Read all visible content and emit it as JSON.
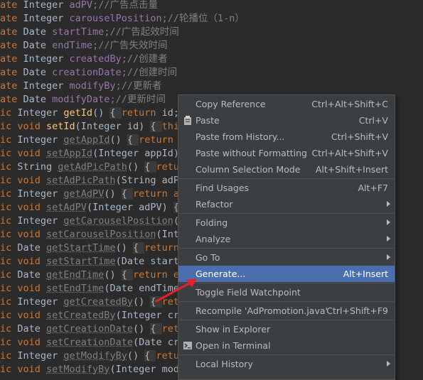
{
  "code": {
    "lines": [
      {
        "parts": [
          {
            "t": "ate ",
            "c": "kw"
          },
          {
            "t": "Integer ",
            "c": ""
          },
          {
            "t": "adPV",
            "c": "fld"
          },
          {
            "t": ";//广告点击量",
            "c": "cm"
          }
        ]
      },
      {
        "parts": [
          {
            "t": "ate ",
            "c": "kw"
          },
          {
            "t": "Integer ",
            "c": ""
          },
          {
            "t": "carouselPosition",
            "c": "fld"
          },
          {
            "t": ";//轮播位（1-n）",
            "c": "cm"
          }
        ]
      },
      {
        "parts": [
          {
            "t": "ate ",
            "c": "kw"
          },
          {
            "t": "Date ",
            "c": ""
          },
          {
            "t": "startTime",
            "c": "fld"
          },
          {
            "t": ";//广告起效时间",
            "c": "cm"
          }
        ]
      },
      {
        "parts": [
          {
            "t": "ate ",
            "c": "kw"
          },
          {
            "t": "Date ",
            "c": ""
          },
          {
            "t": "endTime",
            "c": "fld"
          },
          {
            "t": ";//广告失效时间",
            "c": "cm"
          }
        ]
      },
      {
        "parts": [
          {
            "t": "ate ",
            "c": "kw"
          },
          {
            "t": "Integer ",
            "c": ""
          },
          {
            "t": "createdBy",
            "c": "fld"
          },
          {
            "t": ";//创建者",
            "c": "cm"
          }
        ]
      },
      {
        "parts": [
          {
            "t": "ate ",
            "c": "kw"
          },
          {
            "t": "Date ",
            "c": ""
          },
          {
            "t": "creationDate",
            "c": "fld"
          },
          {
            "t": ";//创建时间",
            "c": "cm"
          }
        ]
      },
      {
        "parts": [
          {
            "t": "ate ",
            "c": "kw"
          },
          {
            "t": "Integer ",
            "c": ""
          },
          {
            "t": "modifyBy",
            "c": "fld"
          },
          {
            "t": ";//更新者",
            "c": "cm"
          }
        ]
      },
      {
        "parts": [
          {
            "t": "ate ",
            "c": "kw"
          },
          {
            "t": "Date ",
            "c": ""
          },
          {
            "t": "modifyDate",
            "c": "fld"
          },
          {
            "t": ";//更新时间",
            "c": "cm"
          }
        ]
      },
      {
        "parts": [
          {
            "t": "ic ",
            "c": "kw"
          },
          {
            "t": "Integer ",
            "c": ""
          },
          {
            "t": "getId",
            "c": "fn"
          },
          {
            "t": "() ",
            "c": ""
          },
          {
            "t": "{ ",
            "c": "brace"
          },
          {
            "t": "return ",
            "c": "kw"
          },
          {
            "t": "id;",
            "c": ""
          }
        ]
      },
      {
        "parts": [
          {
            "t": "ic ",
            "c": "kw"
          },
          {
            "t": "void ",
            "c": "kw"
          },
          {
            "t": "setId",
            "c": "fn"
          },
          {
            "t": "(Integer id) ",
            "c": ""
          },
          {
            "t": "{ ",
            "c": "brace"
          },
          {
            "t": "this",
            "c": "kw"
          }
        ]
      },
      {
        "parts": [
          {
            "t": "ic ",
            "c": "kw"
          },
          {
            "t": "Integer ",
            "c": ""
          },
          {
            "t": "getAppId",
            "c": "dim"
          },
          {
            "t": "() ",
            "c": ""
          },
          {
            "t": "{ ",
            "c": "brace"
          },
          {
            "t": "return a",
            "c": "kw"
          }
        ]
      },
      {
        "parts": [
          {
            "t": "ic ",
            "c": "kw"
          },
          {
            "t": "void ",
            "c": "kw"
          },
          {
            "t": "setAppId",
            "c": "dim"
          },
          {
            "t": "(Integer appId) ",
            "c": ""
          }
        ]
      },
      {
        "parts": [
          {
            "t": "ic ",
            "c": "kw"
          },
          {
            "t": "String ",
            "c": ""
          },
          {
            "t": "getAdPicPath",
            "c": "dim"
          },
          {
            "t": "() ",
            "c": ""
          },
          {
            "t": "{ ",
            "c": "brace"
          },
          {
            "t": "retur",
            "c": "kw"
          }
        ]
      },
      {
        "parts": [
          {
            "t": "ic ",
            "c": "kw"
          },
          {
            "t": "void ",
            "c": "kw"
          },
          {
            "t": "setAdPicPath",
            "c": "dim"
          },
          {
            "t": "(String adPi",
            "c": ""
          }
        ]
      },
      {
        "parts": [
          {
            "t": "ic ",
            "c": "kw"
          },
          {
            "t": "Integer ",
            "c": ""
          },
          {
            "t": "getAdPV",
            "c": "dim"
          },
          {
            "t": "() ",
            "c": ""
          },
          {
            "t": "{ ",
            "c": "brace"
          },
          {
            "t": "return ad",
            "c": "kw"
          }
        ]
      },
      {
        "parts": [
          {
            "t": "ic ",
            "c": "kw"
          },
          {
            "t": "void ",
            "c": "kw"
          },
          {
            "t": "setAdPV",
            "c": "dim"
          },
          {
            "t": "(Integer adPV) ",
            "c": ""
          },
          {
            "t": "{",
            "c": "brace"
          }
        ]
      },
      {
        "parts": [
          {
            "t": "ic ",
            "c": "kw"
          },
          {
            "t": "Integer ",
            "c": ""
          },
          {
            "t": "getCarouselPosition",
            "c": "dim"
          },
          {
            "t": "()",
            "c": ""
          }
        ]
      },
      {
        "parts": [
          {
            "t": "ic ",
            "c": "kw"
          },
          {
            "t": "void ",
            "c": "kw"
          },
          {
            "t": "setCarouselPosition",
            "c": "dim"
          },
          {
            "t": "(Inte",
            "c": ""
          },
          {
            "t": "                       ositi",
            "c": ""
          }
        ]
      },
      {
        "parts": [
          {
            "t": "ic ",
            "c": "kw"
          },
          {
            "t": "Date ",
            "c": ""
          },
          {
            "t": "getStartTime",
            "c": "dim"
          },
          {
            "t": "() ",
            "c": ""
          },
          {
            "t": "{ ",
            "c": "brace"
          },
          {
            "t": "return",
            "c": "kw"
          }
        ]
      },
      {
        "parts": [
          {
            "t": "ic ",
            "c": "kw"
          },
          {
            "t": "void ",
            "c": "kw"
          },
          {
            "t": "setStartTime",
            "c": "dim"
          },
          {
            "t": "(Date startT",
            "c": ""
          }
        ]
      },
      {
        "parts": [
          {
            "t": "ic ",
            "c": "kw"
          },
          {
            "t": "Date ",
            "c": ""
          },
          {
            "t": "getEndTime",
            "c": "dim"
          },
          {
            "t": "() ",
            "c": ""
          },
          {
            "t": "{ ",
            "c": "brace"
          },
          {
            "t": "return en",
            "c": "kw"
          }
        ]
      },
      {
        "parts": [
          {
            "t": "ic ",
            "c": "kw"
          },
          {
            "t": "void ",
            "c": "kw"
          },
          {
            "t": "setEndTime",
            "c": "dim"
          },
          {
            "t": "(Date endTime)",
            "c": ""
          }
        ]
      },
      {
        "parts": [
          {
            "t": "ic ",
            "c": "kw"
          },
          {
            "t": "Integer ",
            "c": ""
          },
          {
            "t": "getCreatedBy",
            "c": "dim"
          },
          {
            "t": "() ",
            "c": ""
          },
          {
            "t": "{ ",
            "c": "brace"
          },
          {
            "t": "retu",
            "c": "kw"
          }
        ]
      },
      {
        "parts": [
          {
            "t": "ic ",
            "c": "kw"
          },
          {
            "t": "void ",
            "c": "kw"
          },
          {
            "t": "setCreatedBy",
            "c": "dim"
          },
          {
            "t": "(Integer cre",
            "c": ""
          }
        ]
      },
      {
        "parts": [
          {
            "t": "ic ",
            "c": "kw"
          },
          {
            "t": "Date ",
            "c": ""
          },
          {
            "t": "getCreationDate",
            "c": "dim"
          },
          {
            "t": "() ",
            "c": ""
          },
          {
            "t": "{ ",
            "c": "brace"
          },
          {
            "t": "retu",
            "c": "kw"
          }
        ]
      },
      {
        "parts": [
          {
            "t": "ic ",
            "c": "kw"
          },
          {
            "t": "void ",
            "c": "kw"
          },
          {
            "t": "setCreationDate",
            "c": "dim"
          },
          {
            "t": "(Date cre",
            "c": ""
          },
          {
            "t": "                       ionDa",
            "c": ""
          }
        ]
      },
      {
        "parts": [
          {
            "t": "ic ",
            "c": "kw"
          },
          {
            "t": "Integer ",
            "c": ""
          },
          {
            "t": "getModifyBy",
            "c": "dim"
          },
          {
            "t": "() ",
            "c": ""
          },
          {
            "t": "{ ",
            "c": "brace"
          },
          {
            "t": "retur",
            "c": "kw"
          }
        ]
      },
      {
        "parts": [
          {
            "t": "ic ",
            "c": "kw"
          },
          {
            "t": "void ",
            "c": "kw"
          },
          {
            "t": "setModifyBy",
            "c": "dim"
          },
          {
            "t": "(Integer modi",
            "c": ""
          }
        ]
      }
    ]
  },
  "context_menu": {
    "items": [
      {
        "label": "Copy Reference",
        "shortcut": "Ctrl+Alt+Shift+C",
        "icon": "",
        "submenu": false,
        "selected": false
      },
      {
        "label": "Paste",
        "shortcut": "Ctrl+V",
        "icon": "clipboard-icon",
        "submenu": false,
        "selected": false
      },
      {
        "label": "Paste from History...",
        "shortcut": "Ctrl+Shift+V",
        "icon": "",
        "submenu": false,
        "selected": false
      },
      {
        "label": "Paste without Formatting",
        "shortcut": "Ctrl+Alt+Shift+V",
        "icon": "",
        "submenu": false,
        "selected": false
      },
      {
        "label": "Column Selection Mode",
        "shortcut": "Alt+Shift+Insert",
        "icon": "",
        "submenu": false,
        "selected": false
      },
      {
        "separator": true
      },
      {
        "label": "Find Usages",
        "shortcut": "Alt+F7",
        "icon": "",
        "submenu": false,
        "selected": false
      },
      {
        "label": "Refactor",
        "shortcut": "",
        "icon": "",
        "submenu": true,
        "selected": false
      },
      {
        "separator": true
      },
      {
        "label": "Folding",
        "shortcut": "",
        "icon": "",
        "submenu": true,
        "selected": false
      },
      {
        "label": "Analyze",
        "shortcut": "",
        "icon": "",
        "submenu": true,
        "selected": false
      },
      {
        "separator": true
      },
      {
        "label": "Go To",
        "shortcut": "",
        "icon": "",
        "submenu": true,
        "selected": false
      },
      {
        "label": "Generate...",
        "shortcut": "Alt+Insert",
        "icon": "",
        "submenu": false,
        "selected": true
      },
      {
        "separator": true
      },
      {
        "label": "Toggle Field Watchpoint",
        "shortcut": "",
        "icon": "",
        "submenu": false,
        "selected": false
      },
      {
        "separator": true
      },
      {
        "label": "Recompile 'AdPromotion.java'",
        "shortcut": "Ctrl+Shift+F9",
        "icon": "",
        "submenu": false,
        "selected": false
      },
      {
        "separator": true
      },
      {
        "label": "Show in Explorer",
        "shortcut": "",
        "icon": "",
        "submenu": false,
        "selected": false
      },
      {
        "label": "Open in Terminal",
        "shortcut": "",
        "icon": "terminal-icon",
        "submenu": false,
        "selected": false
      },
      {
        "separator": true
      },
      {
        "label": "Local History",
        "shortcut": "",
        "icon": "",
        "submenu": true,
        "selected": false
      }
    ]
  },
  "colors": {
    "editor_bg": "#2b2b2b",
    "menu_bg": "#3c3f41",
    "selection": "#4b6eaf",
    "annotation_arrow": "#e8202a"
  }
}
